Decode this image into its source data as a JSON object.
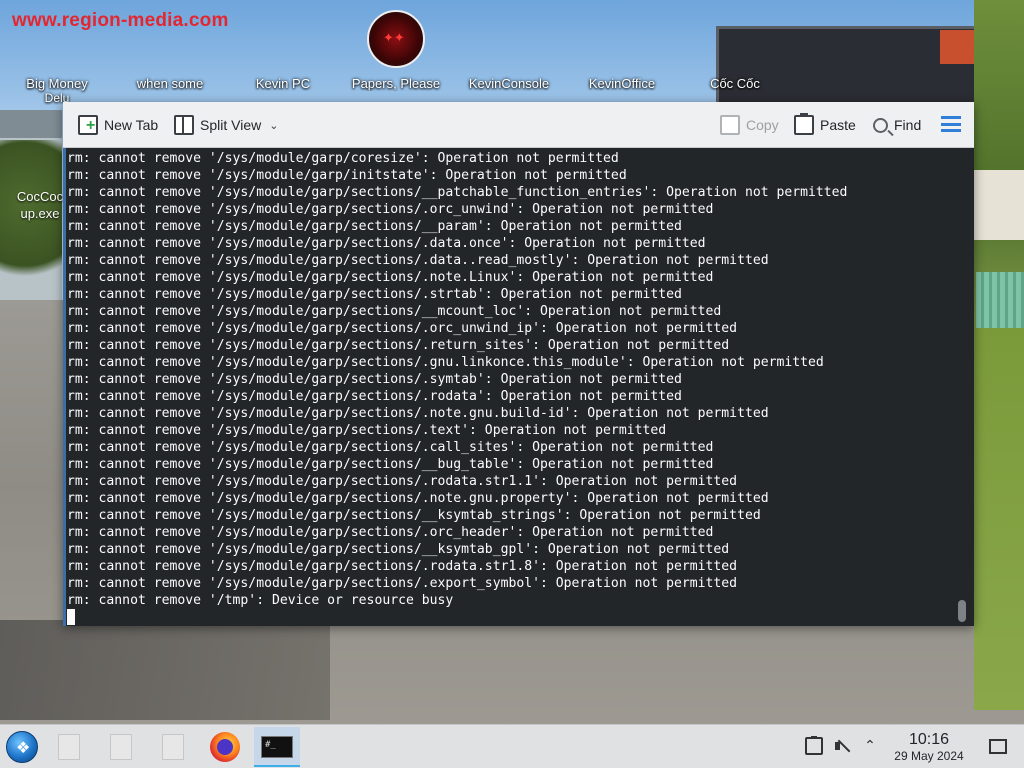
{
  "wallpaper": {
    "watermark": "www.region-media.com"
  },
  "desktop": {
    "icons": [
      {
        "label": "Big Money",
        "sub": "Delu"
      },
      {
        "label": "when some",
        "sub": ""
      },
      {
        "label": "Kevin PC",
        "sub": ""
      },
      {
        "label": "Papers, Please",
        "sub": ""
      },
      {
        "label": "KevinConsole",
        "sub": ""
      },
      {
        "label": "KevinOffice",
        "sub": ""
      },
      {
        "label": "Cốc Cốc",
        "sub": ""
      }
    ],
    "left_icon": {
      "line1": "CocCoc",
      "line2": "up.exe"
    }
  },
  "konsole": {
    "toolbar": {
      "new_tab": "New Tab",
      "split_view": "Split View",
      "copy": "Copy",
      "paste": "Paste",
      "find": "Find"
    },
    "lines": [
      "rm: cannot remove '/sys/module/garp/coresize': Operation not permitted",
      "rm: cannot remove '/sys/module/garp/initstate': Operation not permitted",
      "rm: cannot remove '/sys/module/garp/sections/__patchable_function_entries': Operation not permitted",
      "rm: cannot remove '/sys/module/garp/sections/.orc_unwind': Operation not permitted",
      "rm: cannot remove '/sys/module/garp/sections/__param': Operation not permitted",
      "rm: cannot remove '/sys/module/garp/sections/.data.once': Operation not permitted",
      "rm: cannot remove '/sys/module/garp/sections/.data..read_mostly': Operation not permitted",
      "rm: cannot remove '/sys/module/garp/sections/.note.Linux': Operation not permitted",
      "rm: cannot remove '/sys/module/garp/sections/.strtab': Operation not permitted",
      "rm: cannot remove '/sys/module/garp/sections/__mcount_loc': Operation not permitted",
      "rm: cannot remove '/sys/module/garp/sections/.orc_unwind_ip': Operation not permitted",
      "rm: cannot remove '/sys/module/garp/sections/.return_sites': Operation not permitted",
      "rm: cannot remove '/sys/module/garp/sections/.gnu.linkonce.this_module': Operation not permitted",
      "rm: cannot remove '/sys/module/garp/sections/.symtab': Operation not permitted",
      "rm: cannot remove '/sys/module/garp/sections/.rodata': Operation not permitted",
      "rm: cannot remove '/sys/module/garp/sections/.note.gnu.build-id': Operation not permitted",
      "rm: cannot remove '/sys/module/garp/sections/.text': Operation not permitted",
      "rm: cannot remove '/sys/module/garp/sections/.call_sites': Operation not permitted",
      "rm: cannot remove '/sys/module/garp/sections/__bug_table': Operation not permitted",
      "rm: cannot remove '/sys/module/garp/sections/.rodata.str1.1': Operation not permitted",
      "rm: cannot remove '/sys/module/garp/sections/.note.gnu.property': Operation not permitted",
      "rm: cannot remove '/sys/module/garp/sections/__ksymtab_strings': Operation not permitted",
      "rm: cannot remove '/sys/module/garp/sections/.orc_header': Operation not permitted",
      "rm: cannot remove '/sys/module/garp/sections/__ksymtab_gpl': Operation not permitted",
      "rm: cannot remove '/sys/module/garp/sections/.rodata.str1.8': Operation not permitted",
      "rm: cannot remove '/sys/module/garp/sections/.export_symbol': Operation not permitted",
      "rm: cannot remove '/tmp': Device or resource busy"
    ]
  },
  "taskbar": {
    "clock_time": "10:16",
    "clock_date": "29 May 2024",
    "accent": "#3daee9"
  }
}
